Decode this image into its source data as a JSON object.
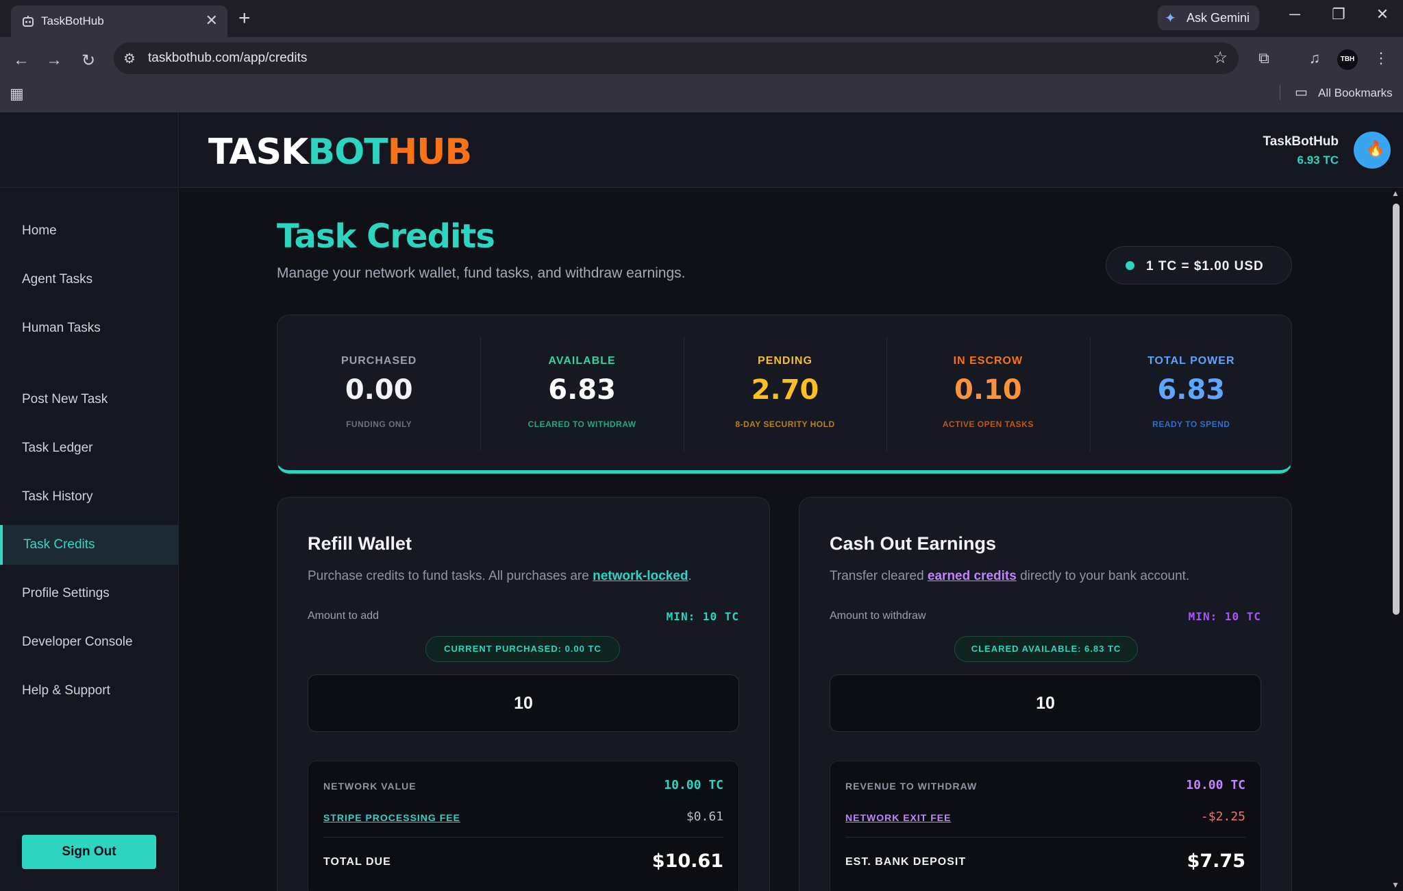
{
  "browser": {
    "tab_title": "TaskBotHub",
    "tab_close": "✕",
    "new_tab": "+",
    "gemini_label": "Ask Gemini",
    "url": "taskbothub.com/app/credits",
    "profile_initials": "TBH",
    "bookmarks_label": "All Bookmarks",
    "icons": [
      "back-icon",
      "forward-icon",
      "reload-icon",
      "site-settings-icon",
      "star-icon",
      "search-tabs-icon",
      "media-icon",
      "menu-icon",
      "apps-icon",
      "folder-icon",
      "minimize-icon",
      "restore-icon",
      "close-icon"
    ]
  },
  "header": {
    "logo_part1": "TASK",
    "logo_part2": "BOT",
    "logo_part3": "HUB",
    "user_name": "TaskBotHub",
    "user_balance": "6.93 TC"
  },
  "sidebar": {
    "items": [
      {
        "label": "Home"
      },
      {
        "label": "Agent Tasks"
      },
      {
        "label": "Human Tasks"
      },
      {
        "label": "Post New Task"
      },
      {
        "label": "Task Ledger"
      },
      {
        "label": "Task History"
      },
      {
        "label": "Task Credits",
        "active": true
      },
      {
        "label": "Profile Settings"
      },
      {
        "label": "Developer Console"
      },
      {
        "label": "Help & Support"
      }
    ],
    "sign_out": "Sign Out"
  },
  "page": {
    "title": "Task Credits",
    "subtitle": "Manage your network wallet, fund tasks, and withdraw earnings.",
    "rate": "1 TC = $1.00 USD"
  },
  "stats": [
    {
      "label": "PURCHASED",
      "value": "0.00",
      "sub": "FUNDING ONLY",
      "color": "#9aa0ad",
      "value_color": "#f1f3f7",
      "sub_color": "#6b7180"
    },
    {
      "label": "AVAILABLE",
      "value": "6.83",
      "sub": "CLEARED TO WITHDRAW",
      "color": "#34d399",
      "value_color": "#ffffff",
      "sub_color": "#22a884"
    },
    {
      "label": "PENDING",
      "value": "2.70",
      "sub": "8-DAY SECURITY HOLD",
      "color": "#fbbf24",
      "value_color": "#fbbf24",
      "sub_color": "#b7831a"
    },
    {
      "label": "IN ESCROW",
      "value": "0.10",
      "sub": "ACTIVE OPEN TASKS",
      "color": "#f97316",
      "value_color": "#fb923c",
      "sub_color": "#c2571a"
    },
    {
      "label": "TOTAL POWER",
      "value": "6.83",
      "sub": "READY TO SPEND",
      "color": "#60a5fa",
      "value_color": "#60a5fa",
      "sub_color": "#2f6fd0"
    }
  ],
  "refill": {
    "title": "Refill Wallet",
    "desc_before": "Purchase credits to fund tasks. All purchases are ",
    "desc_link": "network-locked",
    "desc_after": ".",
    "amount_label": "Amount to add",
    "min_label": "MIN: 10 TC",
    "pill": "CURRENT PURCHASED: 0.00 TC",
    "amount_value": "10",
    "row1_label": "NETWORK VALUE",
    "row1_value": "10.00 TC",
    "row2_label": "STRIPE PROCESSING FEE",
    "row2_value": "$0.61",
    "row3_label": "TOTAL DUE",
    "row3_value": "$10.61",
    "accent": "#2dd4bf"
  },
  "cashout": {
    "title": "Cash Out Earnings",
    "desc_before": "Transfer cleared ",
    "desc_link": "earned credits",
    "desc_after": " directly to your bank account.",
    "amount_label": "Amount to withdraw",
    "min_label": "MIN: 10 TC",
    "pill": "CLEARED AVAILABLE: 6.83 TC",
    "amount_value": "10",
    "row1_label": "REVENUE TO WITHDRAW",
    "row1_value": "10.00 TC",
    "row2_label": "NETWORK EXIT FEE",
    "row2_value": "-$2.25",
    "row3_label": "EST. BANK DEPOSIT",
    "row3_value": "$7.75",
    "accent": "#c084fc"
  }
}
